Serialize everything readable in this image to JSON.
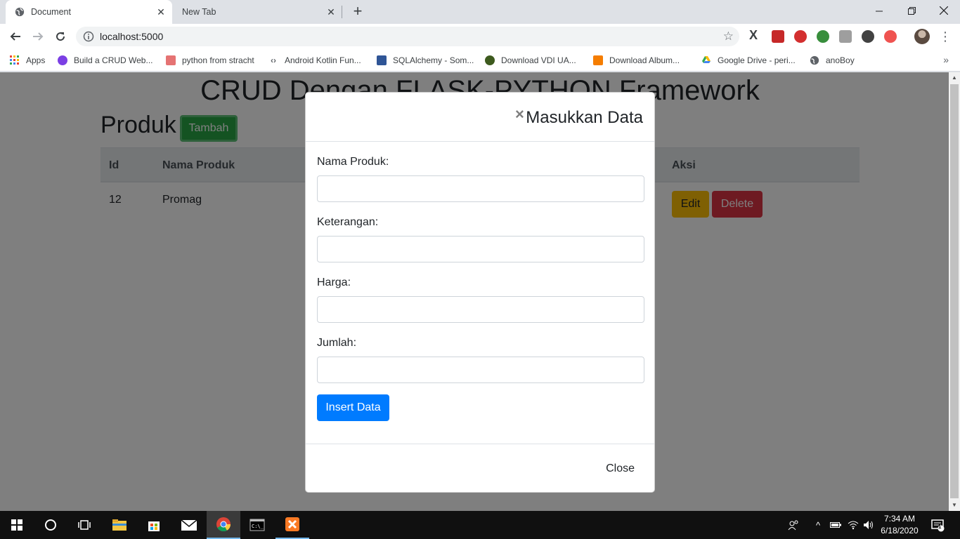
{
  "browser": {
    "tabs": [
      {
        "title": "Document"
      },
      {
        "title": "New Tab"
      }
    ],
    "url": "localhost:5000",
    "bookmarks": [
      {
        "label": "Apps",
        "icon": "apps-grid-icon",
        "color": "#4285f4"
      },
      {
        "label": "Build a CRUD Web...",
        "icon": "site-favicon-icon",
        "color": "#7b3fe4"
      },
      {
        "label": "python from stracht",
        "icon": "site-favicon-icon",
        "color": "#c8102e"
      },
      {
        "label": "Android Kotlin Fun...",
        "icon": "code-brackets-icon",
        "color": "#5f6368"
      },
      {
        "label": "SQLAlchemy - Som...",
        "icon": "site-favicon-icon",
        "color": "#2f5596"
      },
      {
        "label": "Download VDI UA...",
        "icon": "site-favicon-icon",
        "color": "#3d5a1e"
      },
      {
        "label": "Download Album...",
        "icon": "blogger-icon",
        "color": "#f57d00"
      },
      {
        "label": "Google Drive - peri...",
        "icon": "google-drive-icon",
        "color": "#34a853"
      },
      {
        "label": "anoBoy",
        "icon": "globe-icon",
        "color": "#5f6368"
      }
    ]
  },
  "page": {
    "title": "CRUD Dengan FLASK-PYTHON Framework",
    "section_title": "Produk",
    "add_button": "Tambah",
    "table": {
      "headers": {
        "id": "Id",
        "name": "Nama Produk",
        "action": "Aksi"
      },
      "rows": [
        {
          "id": "12",
          "name": "Promag",
          "edit": "Edit",
          "delete": "Delete"
        }
      ]
    }
  },
  "modal": {
    "title": "Masukkan Data",
    "close_symbol": "×",
    "fields": [
      {
        "label": "Nama Produk:",
        "value": ""
      },
      {
        "label": "Keterangan:",
        "value": ""
      },
      {
        "label": "Harga:",
        "value": ""
      },
      {
        "label": "Jumlah:",
        "value": ""
      }
    ],
    "submit": "Insert Data",
    "footer_close": "Close"
  },
  "taskbar": {
    "time": "7:34 AM",
    "date": "6/18/2020",
    "notification_count": "1"
  },
  "colors": {
    "primary": "#007bff",
    "success": "#28a745",
    "warning": "#ffc107",
    "danger": "#dc3545"
  }
}
